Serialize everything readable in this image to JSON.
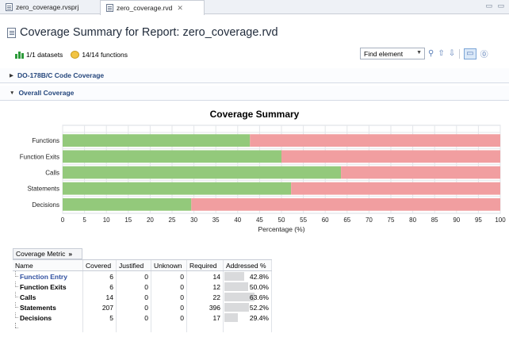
{
  "tabs": [
    {
      "label": "zero_coverage.rvsprj",
      "active": false
    },
    {
      "label": "zero_coverage.rvd",
      "active": true,
      "close": "✕"
    }
  ],
  "window_controls": "▭ ▭",
  "title": "Coverage Summary for Report: zero_coverage.rvd",
  "info": {
    "datasets": "1/1 datasets",
    "functions": "14/14 functions"
  },
  "find": {
    "value": "Find element",
    "caret": "▼"
  },
  "sections": [
    {
      "label": "DO-178B/C Code Coverage",
      "expanded": false,
      "twisty": "▶"
    },
    {
      "label": "Overall Coverage",
      "expanded": true,
      "twisty": "▼"
    }
  ],
  "chart_data": {
    "type": "bar",
    "orientation": "horizontal",
    "stacked": true,
    "title": "Coverage Summary",
    "xlabel": "Percentage (%)",
    "ylabel": "",
    "xlim": [
      0,
      100
    ],
    "xticks": [
      "0",
      "5",
      "10",
      "15",
      "20",
      "25",
      "30",
      "35",
      "40",
      "45",
      "50",
      "55",
      "60",
      "65",
      "70",
      "75",
      "80",
      "85",
      "90",
      "95",
      "100"
    ],
    "categories": [
      "Functions",
      "Function Exits",
      "Calls",
      "Statements",
      "Decisions"
    ],
    "series": [
      {
        "values": [
          42.8,
          50.0,
          63.6,
          52.2,
          29.4
        ],
        "color": "#93c97b"
      },
      {
        "values": [
          57.2,
          50.0,
          36.4,
          47.8,
          70.6
        ],
        "color": "#f19ea0"
      }
    ],
    "grid": true
  },
  "table": {
    "metric_header": "Coverage Metric",
    "metric_header_icon": "»",
    "columns": [
      "Name",
      "Covered",
      "Justified",
      "Unknown",
      "Required",
      "Addressed %"
    ],
    "rows": [
      {
        "name": "Function Entry",
        "covered": "6",
        "justified": "0",
        "unknown": "0",
        "required": "14",
        "addressed": "42.8%",
        "pct": 42.8
      },
      {
        "name": "Function Exits",
        "covered": "6",
        "justified": "0",
        "unknown": "0",
        "required": "12",
        "addressed": "50.0%",
        "pct": 50.0
      },
      {
        "name": "Calls",
        "covered": "14",
        "justified": "0",
        "unknown": "0",
        "required": "22",
        "addressed": "63.6%",
        "pct": 63.6
      },
      {
        "name": "Statements",
        "covered": "207",
        "justified": "0",
        "unknown": "0",
        "required": "396",
        "addressed": "52.2%",
        "pct": 52.2
      },
      {
        "name": "Decisions",
        "covered": "5",
        "justified": "0",
        "unknown": "0",
        "required": "17",
        "addressed": "29.4%",
        "pct": 29.4
      }
    ]
  },
  "colors": {
    "accent": "#24467c",
    "covered": "#93c97b",
    "uncovered": "#f19ea0"
  }
}
